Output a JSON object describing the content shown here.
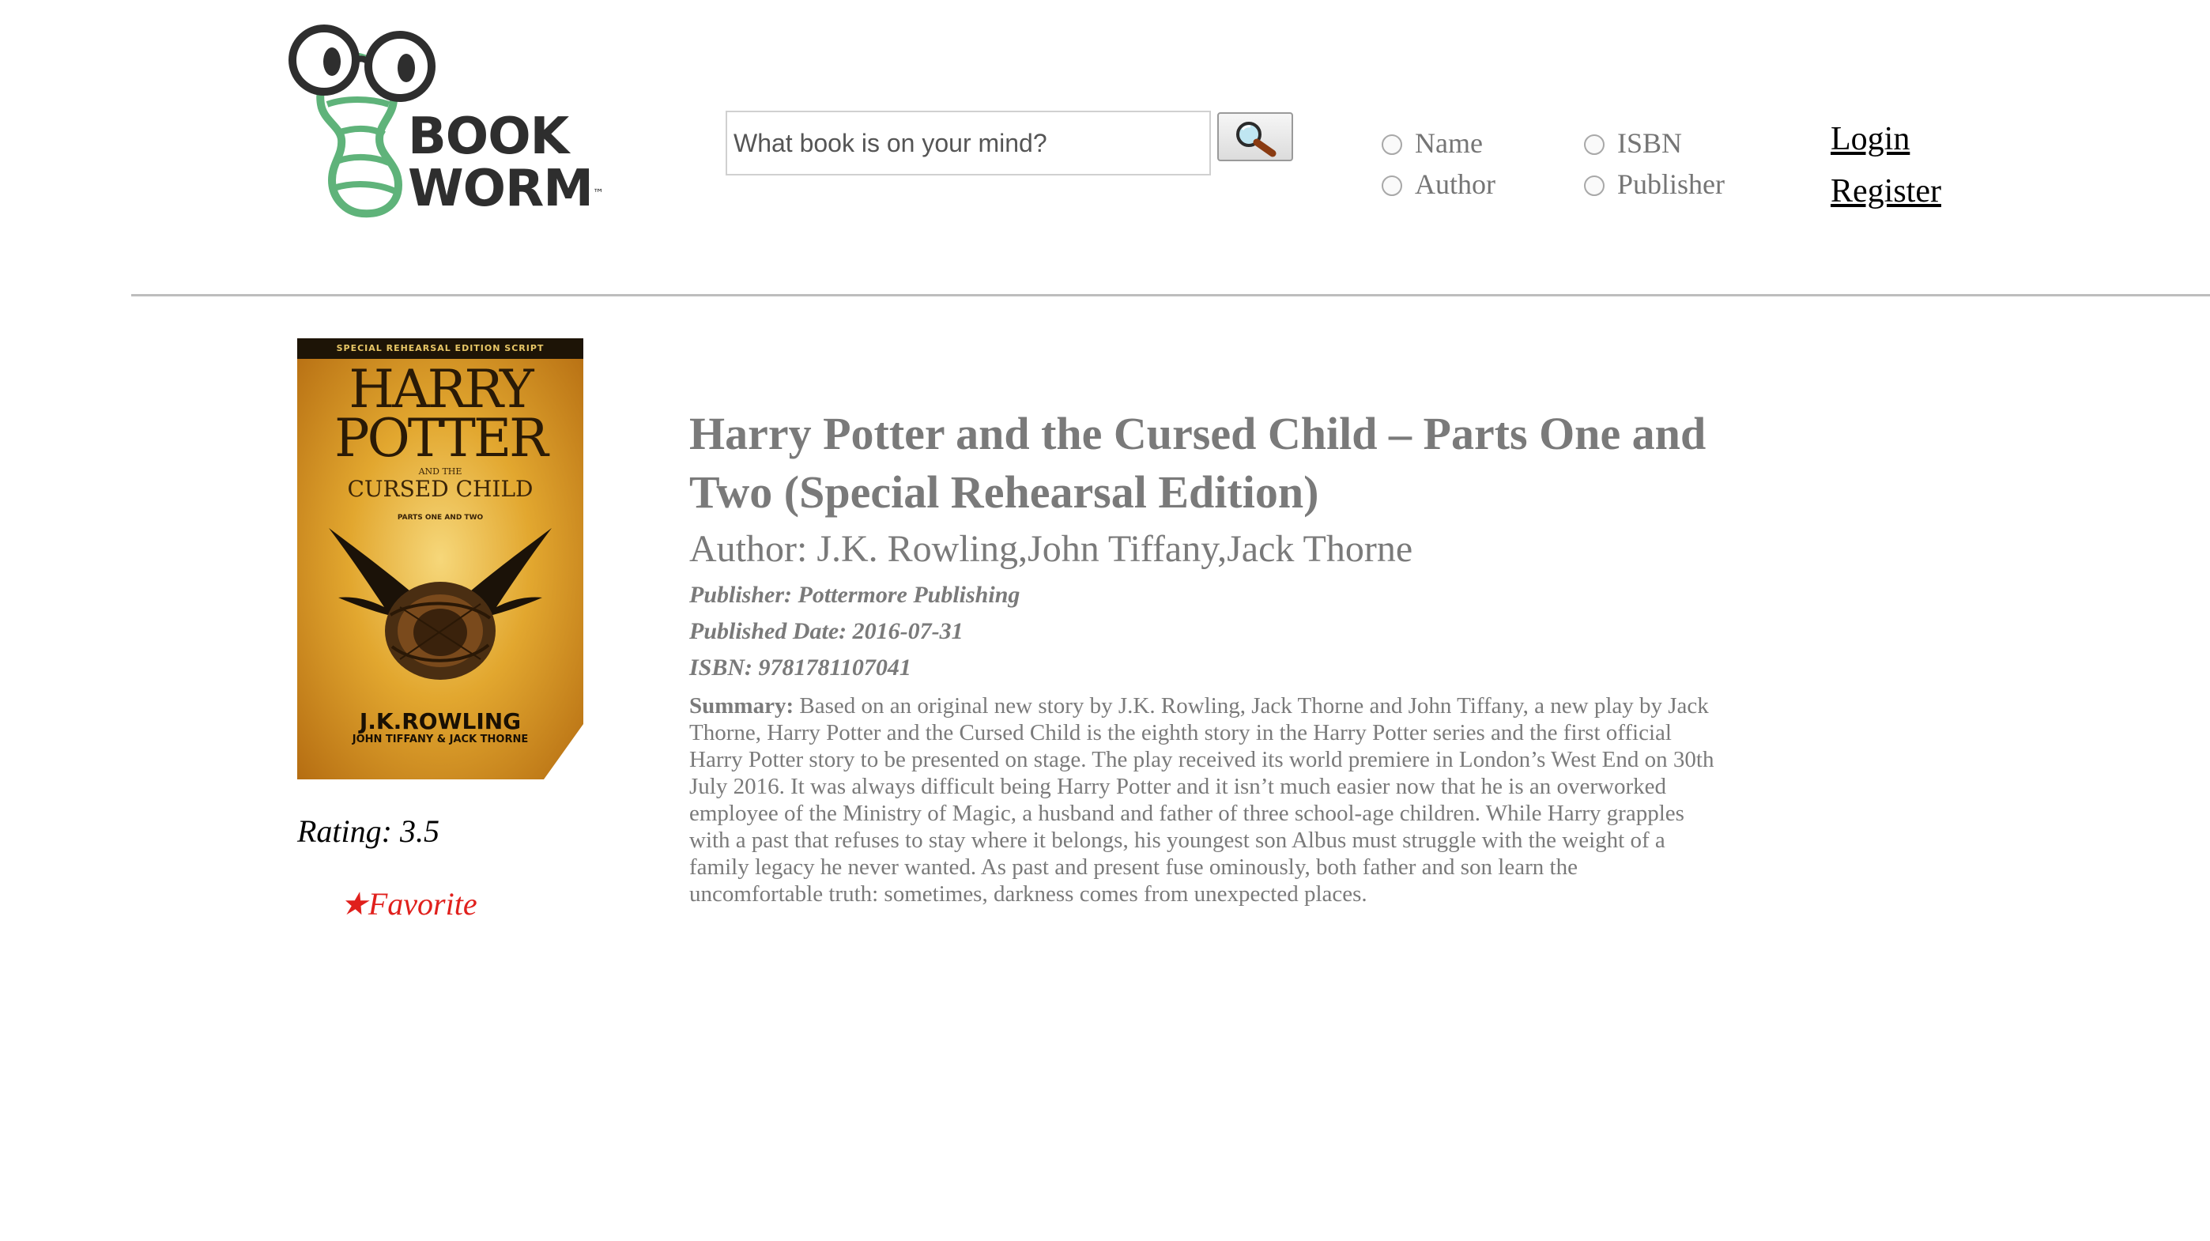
{
  "header": {
    "logo": {
      "line1": "BOOK",
      "line2": "WORM",
      "trademark": "™"
    },
    "search": {
      "placeholder": "What book is on your mind?",
      "value": ""
    },
    "search_options": [
      {
        "label": "Name",
        "checked": false
      },
      {
        "label": "Author",
        "checked": false
      },
      {
        "label": "ISBN",
        "checked": false
      },
      {
        "label": "Publisher",
        "checked": false
      }
    ],
    "login_label": "Login",
    "register_label": "Register"
  },
  "book": {
    "cover": {
      "banner": "SPECIAL REHEARSAL EDITION SCRIPT",
      "title_line1": "HARRY",
      "title_line2": "POTTER",
      "and_the": "AND THE",
      "subtitle": "CURSED CHILD",
      "parts": "PARTS ONE AND TWO",
      "author": "J.K.ROWLING",
      "coauthors": "JOHN TIFFANY & JACK THORNE"
    },
    "rating_text": "Rating: 3.5",
    "favorite_label": "★Favorite",
    "title": "Harry Potter and the Cursed Child – Parts One and Two (Special Rehearsal Edition)",
    "author_line": "Author: J.K. Rowling,John Tiffany,Jack Thorne",
    "publisher_line": "Publisher: Pottermore Publishing",
    "published_date_line": "Published Date: 2016-07-31",
    "isbn_line": "ISBN: 9781781107041",
    "summary_label": "Summary:",
    "summary": " Based on an original new story by J.K. Rowling, Jack Thorne and John Tiffany, a new play by Jack Thorne, Harry Potter and the Cursed Child is the eighth story in the Harry Potter series and the first official Harry Potter story to be presented on stage. The play received its world premiere in London’s West End on 30th July 2016. It was always difficult being Harry Potter and it isn’t much easier now that he is an overworked employee of the Ministry of Magic, a husband and father of three school-age children. While Harry grapples with a past that refuses to stay where it belongs, his youngest son Albus must struggle with the weight of a family legacy he never wanted. As past and present fuse ominously, both father and son learn the uncomfortable truth: sometimes, darkness comes from unexpected places."
  },
  "colors": {
    "logo_green": "#5fb37a",
    "logo_dark": "#2e2e2e",
    "text_gray": "#7a7a7a",
    "favorite_red": "#e0201c",
    "divider": "#bdbdbd"
  },
  "icons": {
    "search_button": "magnifier-icon",
    "logo": "bookworm-logo-icon"
  }
}
